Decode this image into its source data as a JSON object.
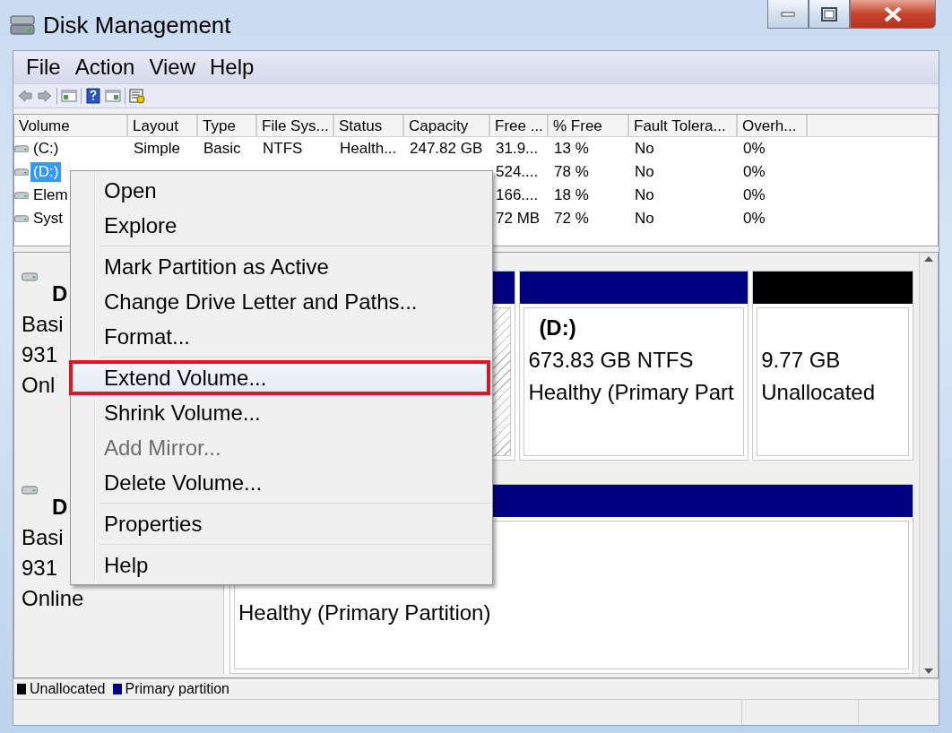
{
  "window": {
    "title": "Disk Management"
  },
  "menu_bar": [
    "File",
    "Action",
    "View",
    "Help"
  ],
  "volume_table": {
    "columns": [
      "Volume",
      "Layout",
      "Type",
      "File Sys...",
      "Status",
      "Capacity",
      "Free ...",
      "% Free",
      "Fault Tolera...",
      "Overh..."
    ],
    "rows": [
      {
        "selected": false,
        "cells": [
          "(C:)",
          "Simple",
          "Basic",
          "NTFS",
          "Health...",
          "247.82 GB",
          "31.9...",
          "13 %",
          "No",
          "0%"
        ]
      },
      {
        "selected": true,
        "cells": [
          "(D:)",
          "",
          "",
          "",
          "",
          "",
          "524....",
          "78 %",
          "No",
          "0%"
        ]
      },
      {
        "selected": false,
        "cells": [
          "Elem",
          "",
          "",
          "",
          "",
          "",
          "166....",
          "18 %",
          "No",
          "0%"
        ]
      },
      {
        "selected": false,
        "cells": [
          "Syst",
          "",
          "",
          "",
          "",
          "",
          "72 MB",
          "72 %",
          "No",
          "0%"
        ]
      }
    ]
  },
  "disks": [
    {
      "name": "D",
      "lines": [
        "Basi",
        "931",
        "Onl"
      ],
      "partitions": [
        {
          "kind": "primary",
          "selected": true
        },
        {
          "kind": "primary",
          "selected": false,
          "name": "(D:)",
          "lines": [
            "673.83 GB NTFS",
            "Healthy (Primary Part"
          ]
        },
        {
          "kind": "unallocated",
          "selected": false,
          "lines": [
            "9.77 GB",
            "Unallocated"
          ]
        }
      ]
    },
    {
      "name": "D",
      "lines": [
        "Basi",
        "931",
        "Online"
      ],
      "partitions": [
        {
          "kind": "primary",
          "selected": false,
          "lines": [
            "Healthy (Primary Partition)"
          ]
        }
      ]
    }
  ],
  "legend": [
    {
      "label": "Unallocated",
      "color": "#000000"
    },
    {
      "label": "Primary partition",
      "color": "#000080"
    }
  ],
  "context_menu": {
    "groups": [
      [
        {
          "label": "Open",
          "disabled": false,
          "highlighted": false
        },
        {
          "label": "Explore",
          "disabled": false,
          "highlighted": false
        }
      ],
      [
        {
          "label": "Mark Partition as Active",
          "disabled": false,
          "highlighted": false
        },
        {
          "label": "Change Drive Letter and Paths...",
          "disabled": false,
          "highlighted": false
        },
        {
          "label": "Format...",
          "disabled": false,
          "highlighted": false
        }
      ],
      [
        {
          "label": "Extend Volume...",
          "disabled": false,
          "highlighted": true
        },
        {
          "label": "Shrink Volume...",
          "disabled": false,
          "highlighted": false
        },
        {
          "label": "Add Mirror...",
          "disabled": true,
          "highlighted": false
        },
        {
          "label": "Delete Volume...",
          "disabled": false,
          "highlighted": false
        }
      ],
      [
        {
          "label": "Properties",
          "disabled": false,
          "highlighted": false
        }
      ],
      [
        {
          "label": "Help",
          "disabled": false,
          "highlighted": false
        }
      ]
    ]
  }
}
